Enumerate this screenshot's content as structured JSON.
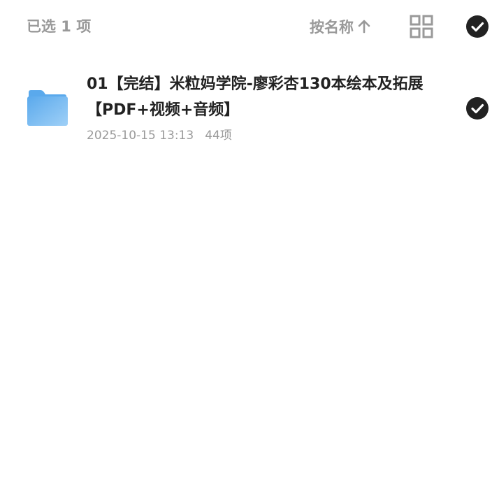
{
  "toolbar": {
    "selected_label": "已选 1 项",
    "sort_label": "按名称",
    "sort_direction_icon": "arrow-up-icon",
    "view_toggle_icon": "grid-view-icon",
    "select_all_icon": "check-circle-icon",
    "select_all_checked": true
  },
  "files": [
    {
      "type_icon": "folder-icon",
      "name": "01【完结】米粒妈学院-廖彩杏130本绘本及拓展【PDF+视频+音频】",
      "modified": "2025-10-15 13:13",
      "item_count": "44项",
      "checked": true
    }
  ],
  "colors": {
    "folder_light": "#9fd0f7",
    "folder_dark": "#5aa9ec",
    "check_fill": "#222222",
    "muted_text": "#999999"
  }
}
